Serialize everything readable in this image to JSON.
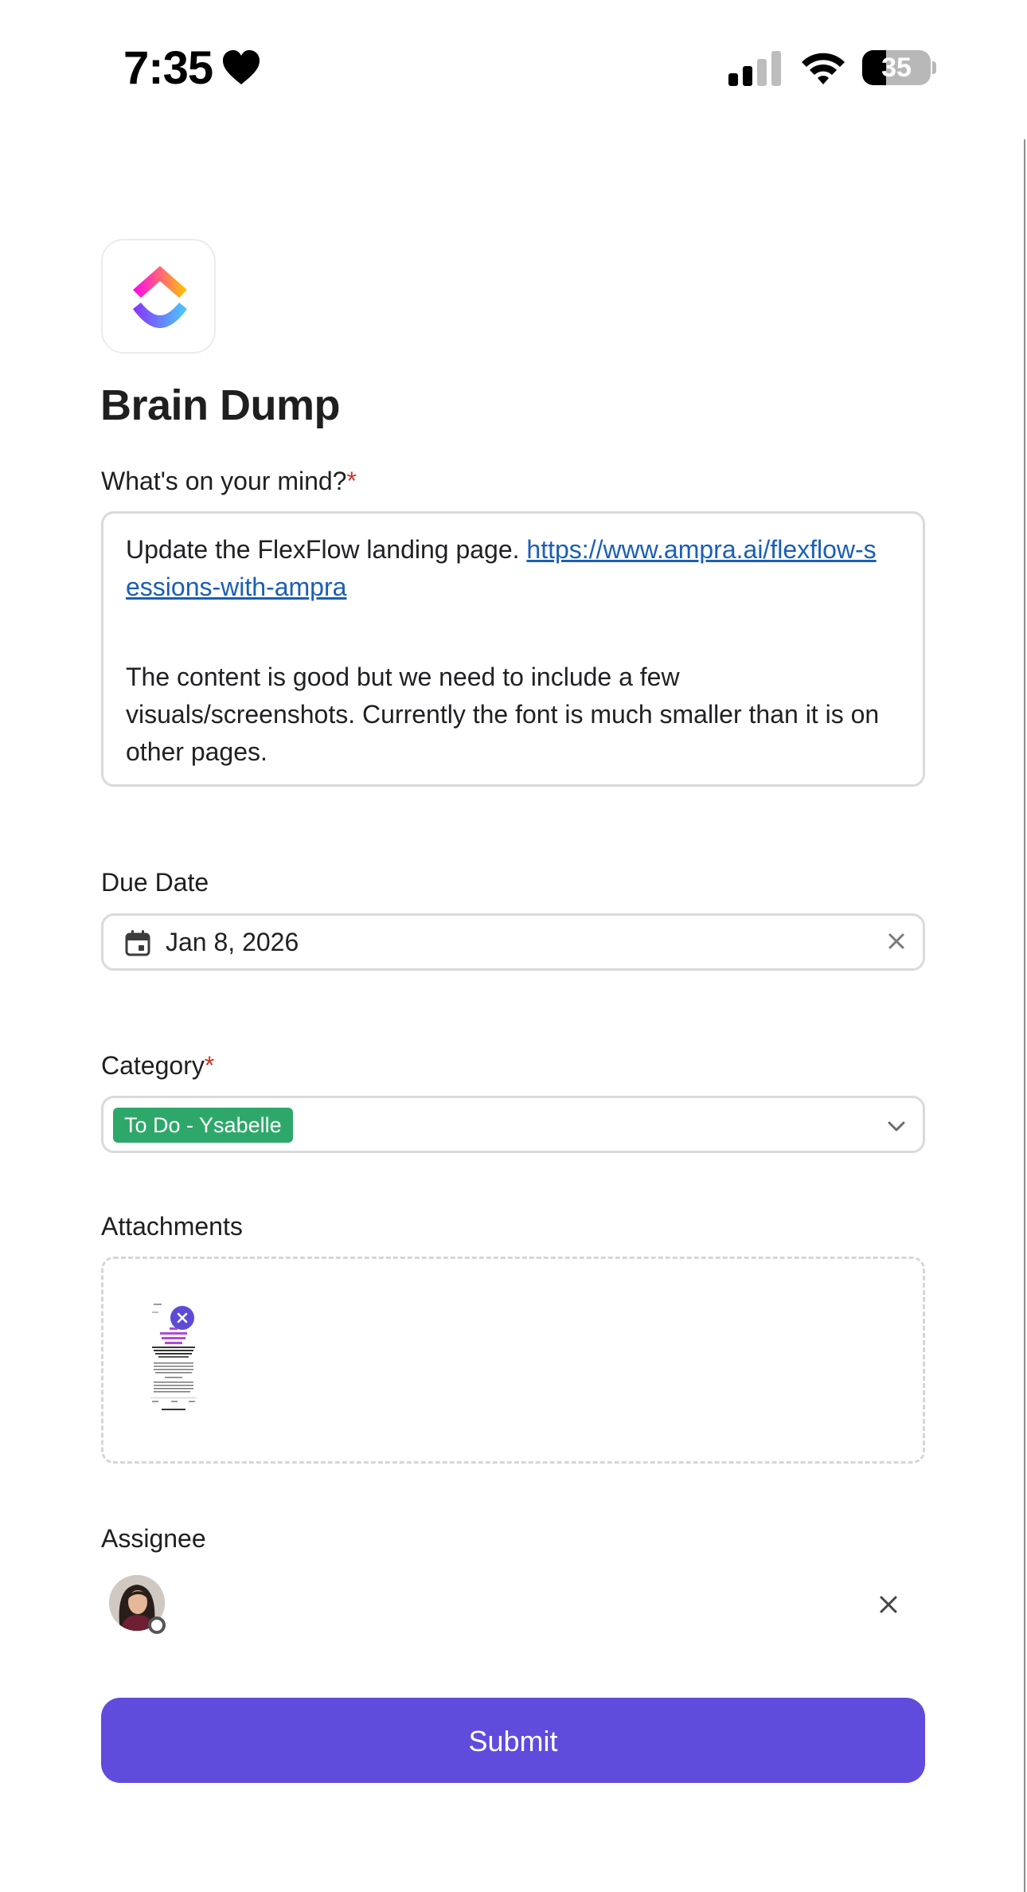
{
  "status_bar": {
    "time": "7:35",
    "battery": "35",
    "battery_level": 0.35,
    "icons": [
      "heart-icon",
      "cellular-signal-icon",
      "wifi-icon",
      "battery-icon"
    ]
  },
  "form": {
    "logo_icon": "clickup-logo-icon",
    "title": "Brain Dump",
    "mind": {
      "label": "What's on your mind?",
      "required_mark": "*",
      "text_before_link": "Update the FlexFlow landing page. ",
      "link_line1": "https://www.ampra.ai/flexflow-s",
      "link_line2": "essions-with-ampra",
      "paragraph2": "The content is good but we need to include a few visuals/screenshots. Currently the font is much smaller than it is on other pages."
    },
    "due_date": {
      "label": "Due Date",
      "value": "Jan 8, 2026",
      "icons": [
        "calendar-icon",
        "clear-icon"
      ]
    },
    "category": {
      "label": "Category",
      "required_mark": "*",
      "selected": "To Do - Ysabelle",
      "tag_color": "#2ea86a",
      "icons": [
        "chevron-down-icon"
      ]
    },
    "attachments": {
      "label": "Attachments",
      "icons": [
        "remove-attachment-icon"
      ]
    },
    "assignee": {
      "label": "Assignee",
      "icons": [
        "avatar",
        "clear-icon"
      ]
    },
    "submit_label": "Submit",
    "accent_color": "#5f4bdc"
  }
}
